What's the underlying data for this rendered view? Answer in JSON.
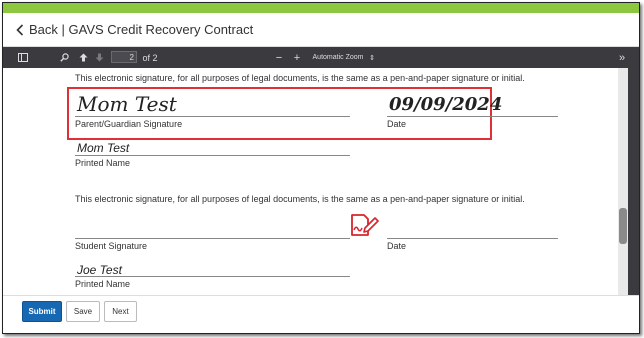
{
  "header": {
    "title": "Back | GAVS Credit Recovery Contract"
  },
  "pdf_toolbar": {
    "current_page": "2",
    "page_total": "of 2",
    "zoom_minus": "−",
    "zoom_plus": "+",
    "zoom_label": "Automatic Zoom",
    "zoom_caret": "⇕",
    "more": "»"
  },
  "document": {
    "statement_1": "This electronic signature, for all purposes of legal documents, is the same as a pen-and-paper signature or initial.",
    "parent_signature": "Mom Test",
    "parent_signature_label": "Parent/Guardian Signature",
    "parent_date": "09/09/2024",
    "parent_date_label": "Date",
    "parent_printed_name": "Mom Test",
    "printed_name_label_1": "Printed Name",
    "statement_2": "This electronic signature, for all purposes of legal documents, is the same as a pen-and-paper signature or initial.",
    "student_signature_label": "Student Signature",
    "student_date_label": "Date",
    "student_printed_name": "Joe Test",
    "printed_name_label_2": "Printed Name"
  },
  "footer": {
    "submit_label": "Submit",
    "save_label": "Save",
    "next_label": "Next"
  },
  "colors": {
    "accent_green": "#8dc63f",
    "toolbar_dark": "#3a3a3f",
    "highlight_red": "#e03035",
    "primary_blue": "#1668b2"
  }
}
